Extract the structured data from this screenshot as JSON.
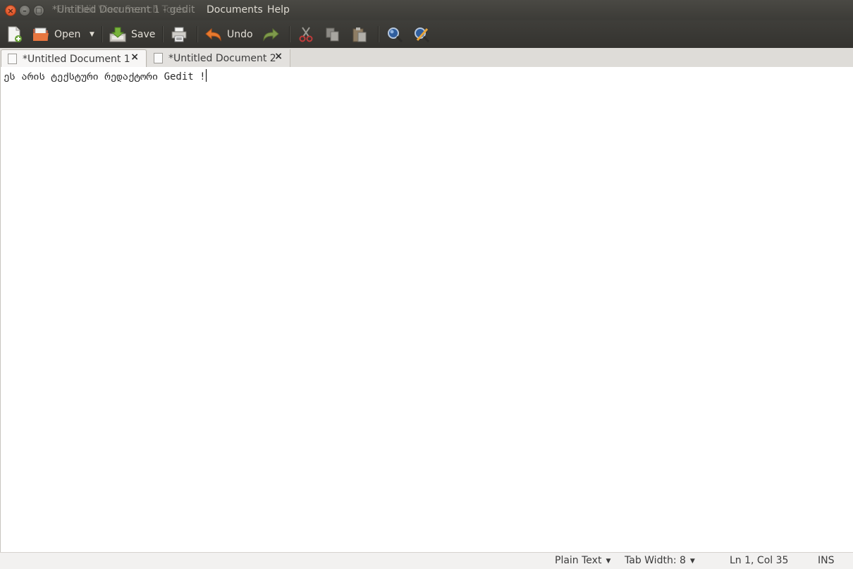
{
  "window": {
    "title": "*Untitled Document 1 - gedit",
    "menu_overlap_text": "File  Edit  View  Search  Tools",
    "menu": [
      "Documents",
      "Help"
    ]
  },
  "toolbar": {
    "open_label": "Open",
    "save_label": "Save",
    "undo_label": "Undo"
  },
  "tabs": [
    {
      "label": "*Untitled Document 1",
      "close": "×"
    },
    {
      "label": "*Untitled Document 2",
      "close": "×"
    }
  ],
  "editor": {
    "text": "ეს არის ტექსტური რედაქტორი Gedit !"
  },
  "statusbar": {
    "language": "Plain Text",
    "tab_width": "Tab Width: 8",
    "position": "Ln 1, Col 35",
    "mode": "INS"
  },
  "colors": {
    "titlebar": "#3c3b37",
    "toolbar": "#3a3935",
    "close_button": "#e55b2c",
    "editor_bg": "#ffffff"
  }
}
